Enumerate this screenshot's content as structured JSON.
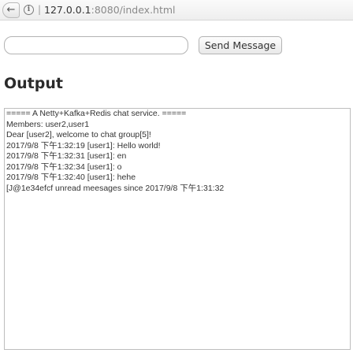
{
  "browser": {
    "back_glyph": "←",
    "info_glyph": "i",
    "separator": "|",
    "url_host": "127.0.0.1",
    "url_path": ":8080/index.html"
  },
  "composer": {
    "input_value": "",
    "input_placeholder": "",
    "send_label": "Send Message"
  },
  "output": {
    "heading": "Output",
    "lines": [
      "===== A Netty+Kafka+Redis chat service. =====",
      "Members: user2,user1",
      "Dear [user2], welcome to chat group[5]!",
      "2017/9/8 下午1:32:19 [user1]: Hello world!",
      "2017/9/8 下午1:32:31 [user1]: en",
      "2017/9/8 下午1:32:34 [user1]: o",
      "2017/9/8 下午1:32:40 [user1]: hehe",
      "[J@1e34efcf unread meesages since 2017/9/8 下午1:31:32"
    ]
  }
}
